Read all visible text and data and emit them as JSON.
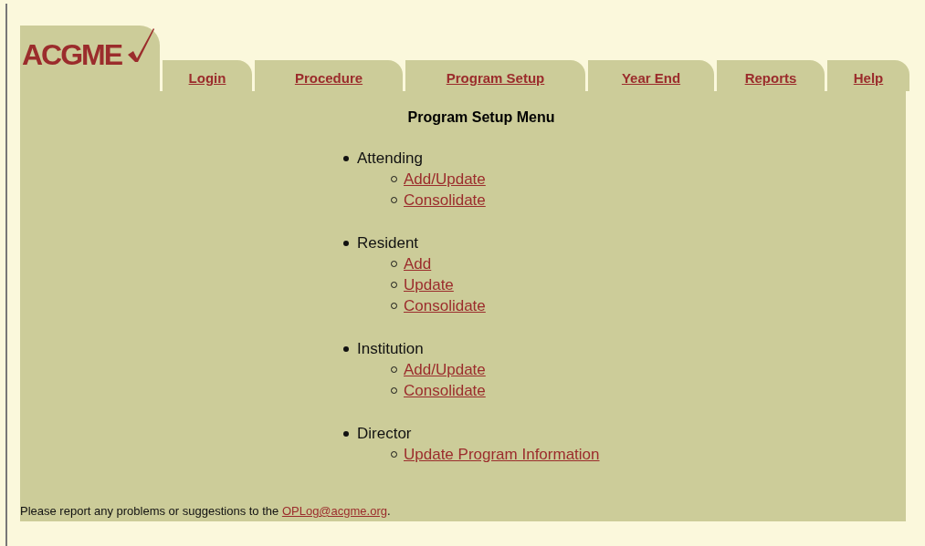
{
  "logo": {
    "text": "ACGME"
  },
  "tabs": [
    {
      "label": "Login"
    },
    {
      "label": "Procedure"
    },
    {
      "label": "Program Setup"
    },
    {
      "label": "Year End"
    },
    {
      "label": "Reports"
    },
    {
      "label": "Help"
    }
  ],
  "title": "Program Setup Menu",
  "menu": [
    {
      "label": "Attending",
      "children": [
        {
          "label": "Add/Update"
        },
        {
          "label": "Consolidate"
        }
      ]
    },
    {
      "label": "Resident",
      "children": [
        {
          "label": "Add"
        },
        {
          "label": "Update"
        },
        {
          "label": "Consolidate"
        }
      ]
    },
    {
      "label": "Institution",
      "children": [
        {
          "label": "Add/Update"
        },
        {
          "label": "Consolidate"
        }
      ]
    },
    {
      "label": "Director",
      "children": [
        {
          "label": "Update Program Information"
        }
      ]
    }
  ],
  "footer": {
    "text": "Please report any problems or suggestions to the ",
    "link": "OPLog@acgme.org",
    "end": "."
  }
}
